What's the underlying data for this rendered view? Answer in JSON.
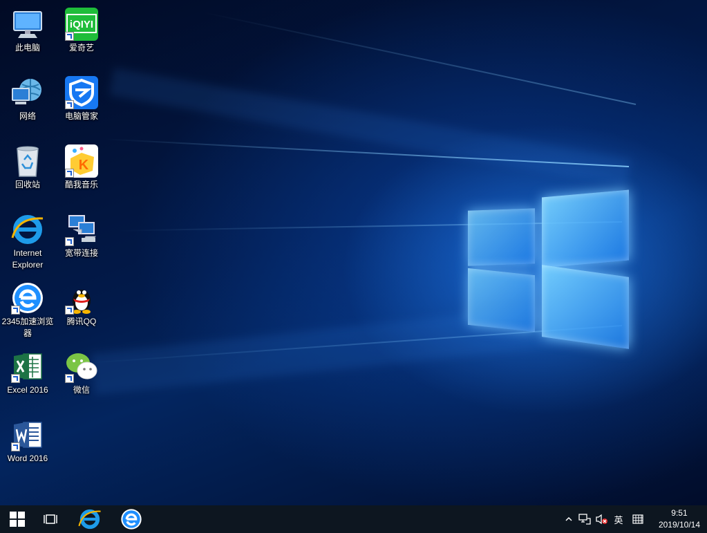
{
  "desktop": {
    "icons": [
      {
        "name": "此电脑",
        "icon": "this-pc-icon"
      },
      {
        "name": "网络",
        "icon": "network-icon"
      },
      {
        "name": "回收站",
        "icon": "recycle-bin-icon"
      },
      {
        "name": "Internet Explorer",
        "icon": "internet-explorer-icon"
      },
      {
        "name": "2345加速浏览器",
        "icon": "2345-browser-icon"
      },
      {
        "name": "Excel 2016",
        "icon": "excel-icon"
      },
      {
        "name": "Word 2016",
        "icon": "word-icon"
      },
      {
        "name": "爱奇艺",
        "icon": "iqiyi-icon",
        "logo_text": "iQIYI"
      },
      {
        "name": "电脑管家",
        "icon": "pc-manager-icon"
      },
      {
        "name": "酷我音乐",
        "icon": "kuwo-music-icon",
        "logo_text": "K"
      },
      {
        "name": "宽带连接",
        "icon": "broadband-connection-icon"
      },
      {
        "name": "腾讯QQ",
        "icon": "qq-icon"
      },
      {
        "name": "微信",
        "icon": "wechat-icon"
      }
    ]
  },
  "taskbar": {
    "start": {
      "icon": "windows-start-icon"
    },
    "task_view": {
      "icon": "task-view-icon"
    },
    "pinned": [
      {
        "icon": "internet-explorer-icon"
      },
      {
        "icon": "2345-browser-icon"
      }
    ],
    "tray": {
      "overflow_icon": "chevron-up-icon",
      "network_icon": "network-status-icon",
      "volume_icon": "volume-muted-icon",
      "ime_label": "英",
      "ime_mode_icon": "ime-mode-icon"
    },
    "clock": {
      "time": "9:51",
      "date": "2019/10/14"
    }
  },
  "colors": {
    "taskbar_bg": "#0d1620",
    "accent_blue": "#1e8fff"
  }
}
